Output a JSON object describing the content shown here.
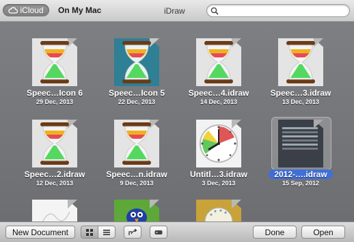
{
  "topbar": {
    "icloud_label": "iCloud",
    "on_my_mac_label": "On My Mac",
    "title": "iDraw",
    "search_placeholder": ""
  },
  "files": [
    {
      "name": "Speec…Icon 6",
      "date": "29 Dec, 2013",
      "thumb": "hourglass"
    },
    {
      "name": "Speec…Icon 5",
      "date": "22 Dec, 2013",
      "thumb": "hourglass-teal"
    },
    {
      "name": "Speec…4.idraw",
      "date": "14 Dec, 2013",
      "thumb": "hourglass"
    },
    {
      "name": "Speec…3.idraw",
      "date": "13 Dec, 2013",
      "thumb": "hourglass"
    },
    {
      "name": "Speec…2.idraw",
      "date": "12 Dec, 2013",
      "thumb": "hourglass"
    },
    {
      "name": "Speec…n.idraw",
      "date": "9 Dec, 2013",
      "thumb": "hourglass"
    },
    {
      "name": "Untitl…3.idraw",
      "date": "3 Dec, 2013",
      "thumb": "clock"
    },
    {
      "name": "2012-….idraw",
      "date": "15 Sep, 2012",
      "thumb": "screenshot",
      "selected": true
    },
    {
      "name": "",
      "date": "",
      "thumb": "sketch"
    },
    {
      "name": "",
      "date": "",
      "thumb": "bird"
    },
    {
      "name": "",
      "date": "",
      "thumb": "sun"
    }
  ],
  "bottombar": {
    "new_document_label": "New Document",
    "done_label": "Done",
    "open_label": "Open"
  },
  "colors": {
    "selection": "#3f6fd8",
    "background": "#7a7b7f"
  }
}
